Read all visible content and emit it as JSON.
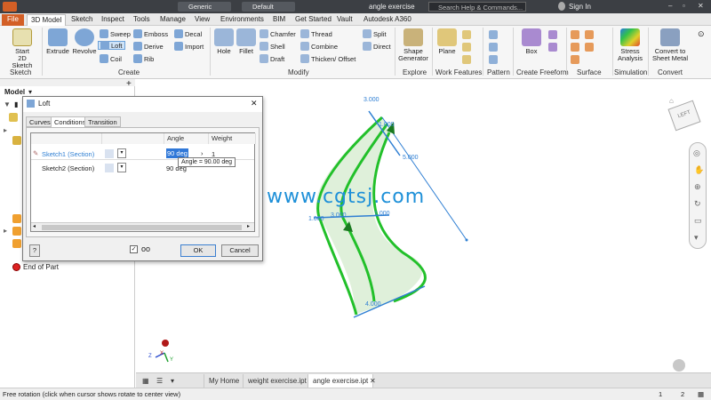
{
  "titlebar": {
    "material": "Generic",
    "appearance": "Default",
    "document": "angle exercise",
    "search_placeholder": "Search Help & Commands...",
    "sign_in": "Sign In"
  },
  "ribbon_tabs": [
    "File",
    "3D Model",
    "Sketch",
    "Inspect",
    "Tools",
    "Manage",
    "View",
    "Environments",
    "BIM",
    "Get Started",
    "Vault",
    "Autodesk A360"
  ],
  "ribbon": {
    "sketch": {
      "start": "Start",
      "start2": "2D Sketch",
      "label": "Sketch"
    },
    "create": {
      "extrude": "Extrude",
      "revolve": "Revolve",
      "sweep": "Sweep",
      "loft": "Loft",
      "coil": "Coil",
      "emboss": "Emboss",
      "derive": "Derive",
      "rib": "Rib",
      "decal": "Decal",
      "import": "Import",
      "label": "Create"
    },
    "modify": {
      "hole": "Hole",
      "fillet": "Fillet",
      "chamfer": "Chamfer",
      "shell": "Shell",
      "draft": "Draft",
      "thread": "Thread",
      "combine": "Combine",
      "thicken": "Thicken/ Offset",
      "split": "Split",
      "direct": "Direct",
      "label": "Modify"
    },
    "explore": {
      "shape": "Shape",
      "generator": "Generator",
      "label": "Explore"
    },
    "workfeatures": {
      "plane": "Plane",
      "label": "Work Features"
    },
    "pattern": {
      "label": "Pattern"
    },
    "freeform": {
      "box": "Box",
      "label": "Create Freeform"
    },
    "surface": {
      "label": "Surface"
    },
    "simulation": {
      "stress": "Stress",
      "analysis": "Analysis",
      "label": "Simulation"
    },
    "convert": {
      "c1": "Convert to",
      "c2": "Sheet Metal",
      "label": "Convert"
    }
  },
  "browser": {
    "title": "Model",
    "end_of_part": "End of Part"
  },
  "dialog": {
    "title": "Loft",
    "tabs": [
      "Curves",
      "Conditions",
      "Transition"
    ],
    "columns": [
      "",
      "",
      "Angle",
      "Weight"
    ],
    "rows": [
      {
        "name": "Sketch1 (Section)",
        "angle": "90 deg",
        "weight": "1"
      },
      {
        "name": "Sketch2 (Section)",
        "angle": "90 deg",
        "weight": ""
      }
    ],
    "tooltip": "Angle = 90.00 deg",
    "help": "?",
    "ok": "OK",
    "cancel": "Cancel"
  },
  "viewport": {
    "dims": [
      "3.000",
      "1.000",
      "5.000",
      "1.000",
      "3.000",
      "1.000",
      "4.000"
    ],
    "viewcube": "LEFT",
    "watermark": "www.cgtsj.com",
    "axes": [
      "X",
      "Y",
      "Z"
    ]
  },
  "doc_tabs": [
    "My Home",
    "weight exercise.ipt",
    "angle exercise.ipt"
  ],
  "status": {
    "text": "Free rotation (click when cursor shows rotate to center view)",
    "n1": "1",
    "n2": "2"
  },
  "colors": {
    "accent": "#d35f26",
    "selection": "#2f7fd3",
    "curve": "#22c02a"
  }
}
